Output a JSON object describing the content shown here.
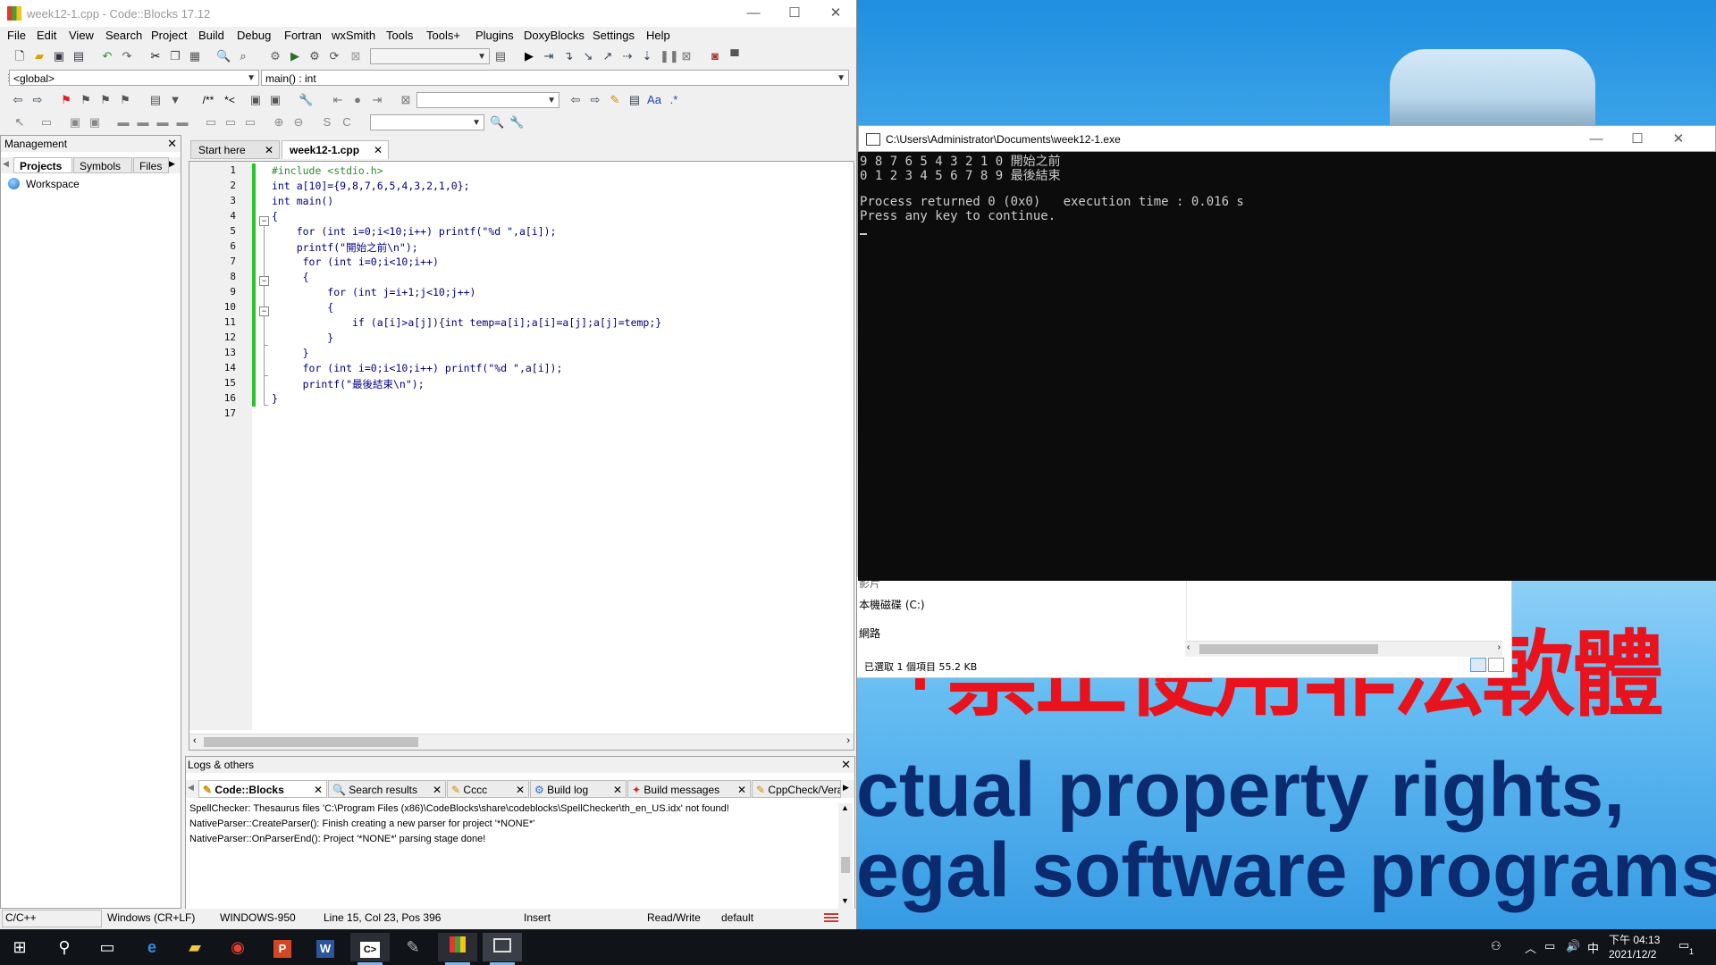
{
  "codeblocks": {
    "title": "week12-1.cpp - Code::Blocks 17.12",
    "menu": [
      "File",
      "Edit",
      "View",
      "Search",
      "Project",
      "Build",
      "Debug",
      "Fortran",
      "wxSmith",
      "Tools",
      "Tools+",
      "Plugins",
      "DoxyBlocks",
      "Settings",
      "Help"
    ],
    "scope_combo": "<global>",
    "function_combo": "main() : int",
    "doxy_label": "/**",
    "doxy_label2": "*<",
    "management": {
      "title": "Management",
      "tabs": [
        "Projects",
        "Symbols",
        "Files"
      ],
      "workspace": "Workspace"
    },
    "editor_tabs": [
      "Start here",
      "week12-1.cpp"
    ],
    "line_numbers": [
      "1",
      "2",
      "3",
      "4",
      "5",
      "6",
      "7",
      "8",
      "9",
      "10",
      "11",
      "12",
      "13",
      "14",
      "15",
      "16",
      "17"
    ],
    "code_lines": [
      "#include <stdio.h>",
      "int a[10]={9,8,7,6,5,4,3,2,1,0};",
      "int main()",
      "{",
      "    for (int i=0;i<10;i++) printf(\"%d \",a[i]);",
      "    printf(\"開始之前\\n\");",
      "     for (int i=0;i<10;i++)",
      "     {",
      "         for (int j=i+1;j<10;j++)",
      "         {",
      "             if (a[i]>a[j]){int temp=a[i];a[i]=a[j];a[j]=temp;}",
      "         }",
      "     }",
      "     for (int i=0;i<10;i++) printf(\"%d \",a[i]);",
      "     printf(\"最後結束\\n\");",
      "}",
      ""
    ],
    "logs": {
      "title": "Logs & others",
      "tabs": [
        "Code::Blocks",
        "Search results",
        "Cccc",
        "Build log",
        "Build messages",
        "CppCheck/Vera"
      ],
      "lines": [
        "SpellChecker: Thesaurus files 'C:\\Program Files (x86)\\CodeBlocks\\share\\codeblocks\\SpellChecker\\th_en_US.idx' not found!",
        "NativeParser::CreateParser(): Finish creating a new parser for project '*NONE*'",
        "NativeParser::OnParserEnd(): Project '*NONE*' parsing stage done!"
      ]
    },
    "status": {
      "language": "C/C++",
      "line_endings": "Windows (CR+LF)",
      "encoding": "WINDOWS-950",
      "position": "Line 15, Col 23, Pos 396",
      "mode": "Insert",
      "access": "Read/Write",
      "profile": "default"
    }
  },
  "console": {
    "title": "C:\\Users\\Administrator\\Documents\\week12-1.exe",
    "lines": [
      "9 8 7 6 5 4 3 2 1 0 開始之前",
      "0 1 2 3 4 5 6 7 8 9 最後結束",
      "",
      "Process returned 0 (0x0)   execution time : 0.016 s",
      "Press any key to continue."
    ]
  },
  "explorer": {
    "row1": "影片",
    "drive": "本機磁碟 (C:)",
    "row3": "網路",
    "status": "已選取 1 個項目  55.2 KB"
  },
  "background": {
    "banner_chinese": "「禁止使用非法軟體",
    "line1": "ctual property rights,",
    "line2": "egal software programs”"
  },
  "taskbar": {
    "time": "下午 04:13",
    "date": "2021/12/2",
    "ime": "中",
    "notif_count": "1"
  }
}
